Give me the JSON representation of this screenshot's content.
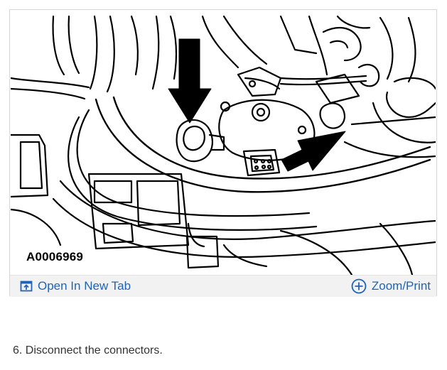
{
  "figure": {
    "figure_id": "A0006969",
    "toolbar": {
      "open_new_tab": {
        "label": "Open In New Tab",
        "icon": "open-new-tab-icon"
      },
      "zoom_print": {
        "label": "Zoom/Print",
        "icon": "plus-circle-icon"
      }
    },
    "accent_color": "#1f63b8"
  },
  "instructions": {
    "step": "6. Disconnect the connectors."
  }
}
